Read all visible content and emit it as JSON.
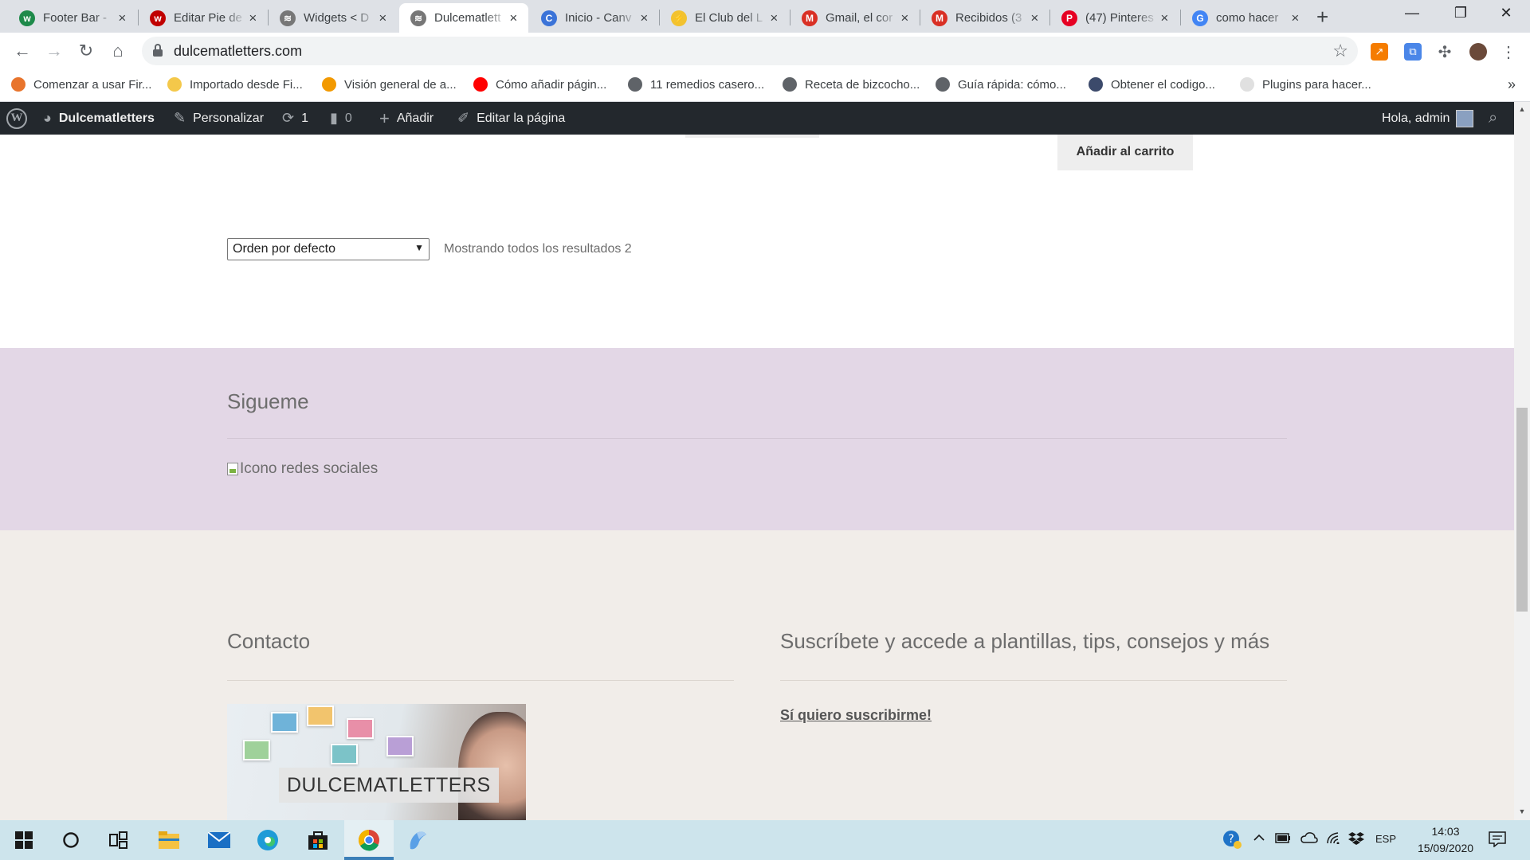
{
  "browser": {
    "tabs": [
      {
        "title": "Footer Bar - ",
        "icon": "woocommerce-icon",
        "color": "#1e8a4a",
        "glyph": "w",
        "active": false
      },
      {
        "title": "Editar Pie de ",
        "icon": "wp-red-icon",
        "color": "#c00000",
        "glyph": "w",
        "active": false
      },
      {
        "title": "Widgets < D",
        "icon": "site-icon",
        "color": "#777777",
        "glyph": "≋",
        "active": false
      },
      {
        "title": "Dulcematlett",
        "icon": "site-icon",
        "color": "#777777",
        "glyph": "≋",
        "active": true
      },
      {
        "title": "Inicio - Canv",
        "icon": "canva-icon",
        "color": "#3b73d8",
        "glyph": "C",
        "active": false
      },
      {
        "title": "El Club del L",
        "icon": "bolt-icon",
        "color": "#f2c230",
        "glyph": "⚡",
        "active": false
      },
      {
        "title": "Gmail, el cor",
        "icon": "gmail-icon",
        "color": "#d93025",
        "glyph": "M",
        "active": false
      },
      {
        "title": "Recibidos (3",
        "icon": "gmail-icon",
        "color": "#d93025",
        "glyph": "M",
        "active": false
      },
      {
        "title": "(47) Pinteres",
        "icon": "pinterest-icon",
        "color": "#e60023",
        "glyph": "P",
        "active": false
      },
      {
        "title": "como hacer",
        "icon": "google-icon",
        "color": "#4285f4",
        "glyph": "G",
        "active": false
      }
    ],
    "url": "dulcematletters.com",
    "bookmarks": [
      {
        "label": "Comenzar a usar Fir...",
        "color": "#e8742c"
      },
      {
        "label": "Importado desde Fi...",
        "color": "#f4c84a"
      },
      {
        "label": "Visión general de a...",
        "color": "#f29900"
      },
      {
        "label": "Cómo añadir págin...",
        "color": "#ff0000"
      },
      {
        "label": "11 remedios casero...",
        "color": "#5f6368"
      },
      {
        "label": "Receta de bizcocho...",
        "color": "#5f6368"
      },
      {
        "label": "Guía rápida: cómo...",
        "color": "#5f6368"
      },
      {
        "label": "Obtener el codigo...",
        "color": "#3c4a6b"
      },
      {
        "label": "Plugins para hacer...",
        "color": "#e0e0e0"
      }
    ]
  },
  "adminbar": {
    "site_name": "Dulcematletters",
    "customize": "Personalizar",
    "updates_count": "1",
    "comments_count": "0",
    "add_new": "Añadir",
    "edit_page": "Editar la página",
    "greeting": "Hola, admin"
  },
  "page": {
    "add_to_cart": "Añadir al carrito",
    "orderby_selected": "Orden por defecto",
    "result_count": "Mostrando todos los resultados 2",
    "follow_title": "Sigueme",
    "social_icon_alt": "Icono redes sociales",
    "contact_title": "Contacto",
    "subscribe_title": "Suscríbete y accede a plantillas, tips, consejos y más",
    "subscribe_link": " Sí quiero suscribirme!",
    "banner_text": "DULCEMATLETTERS"
  },
  "taskbar": {
    "language": "ESP",
    "time": "14:03",
    "date": "15/09/2020"
  }
}
